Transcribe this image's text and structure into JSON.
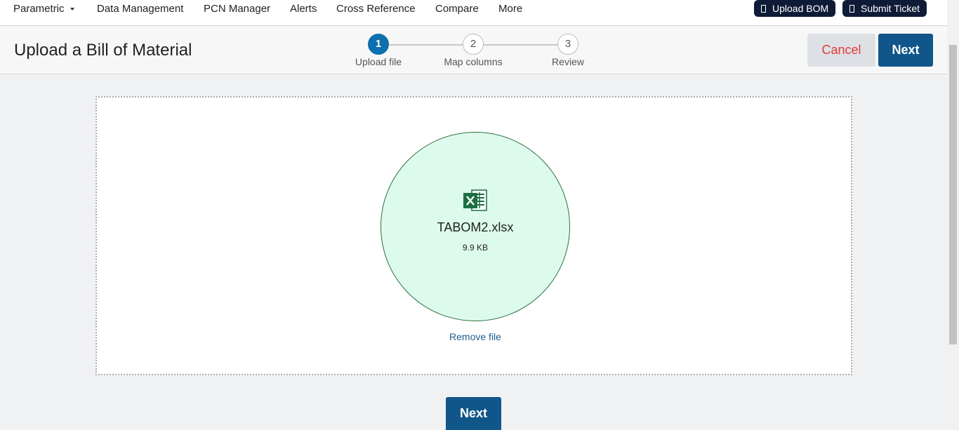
{
  "nav": {
    "items": [
      "Parametric",
      "Data Management",
      "PCN Manager",
      "Alerts",
      "Cross Reference",
      "Compare",
      "More"
    ],
    "upload_bom": "Upload BOM",
    "submit_ticket": "Submit Ticket"
  },
  "header": {
    "title": "Upload a Bill of Material",
    "steps": [
      {
        "number": "1",
        "label": "Upload file"
      },
      {
        "number": "2",
        "label": "Map columns"
      },
      {
        "number": "3",
        "label": "Review"
      }
    ],
    "active_step": 1,
    "cancel_label": "Cancel",
    "next_label": "Next"
  },
  "upload": {
    "file_icon": "excel-icon",
    "file_name": "TABOM2.xlsx",
    "file_size": "9.9 KB",
    "remove_label": "Remove file"
  },
  "footer": {
    "next_label": "Next"
  },
  "colors": {
    "primary": "#11568a",
    "active_step": "#0d6fae",
    "pill_bg": "#0e1b36",
    "cancel_text": "#e53935",
    "file_circle_bg": "#ddfbec",
    "excel_green": "#1d6f42"
  }
}
